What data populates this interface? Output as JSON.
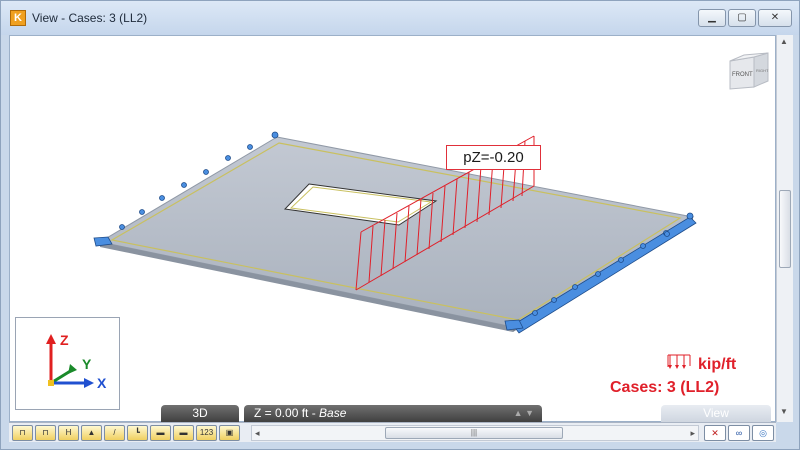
{
  "window": {
    "app_icon": "K",
    "title": "View - Cases: 3 (LL2)",
    "min_icon": "minimize-icon",
    "max_icon": "maximize-icon",
    "close_icon": "close-icon"
  },
  "viewport": {
    "load_label": "pZ=-0.20",
    "nav_cube": {
      "front": "FRONT",
      "right": "RIGHT"
    },
    "axes": {
      "z": "Z",
      "y": "Y",
      "x": "X"
    },
    "legend": {
      "unit": "kip/ft",
      "case": "Cases: 3 (LL2)"
    }
  },
  "bottom_bar": {
    "mode": "3D",
    "elevation": "Z = 0.00 ft - ",
    "elevation_base": "Base",
    "view": "View"
  },
  "toolbar": {
    "buttons": [
      {
        "name": "toolbar-btn-1",
        "glyph": "⊓"
      },
      {
        "name": "toolbar-btn-2",
        "glyph": "⊓"
      },
      {
        "name": "toolbar-btn-3",
        "glyph": "H"
      },
      {
        "name": "toolbar-btn-4",
        "glyph": "▲"
      },
      {
        "name": "toolbar-btn-5",
        "glyph": "/"
      },
      {
        "name": "toolbar-btn-6",
        "glyph": "┗"
      },
      {
        "name": "toolbar-btn-7",
        "glyph": "▬"
      },
      {
        "name": "toolbar-btn-8",
        "glyph": "▬"
      },
      {
        "name": "toolbar-btn-9",
        "glyph": "123"
      },
      {
        "name": "toolbar-btn-10",
        "glyph": "▣"
      }
    ],
    "scroll_left": "◂",
    "scroll_right": "▸",
    "scroll_grip": "|||",
    "right_buttons": [
      {
        "name": "filter-off-icon",
        "glyph": "✕"
      },
      {
        "name": "link-icon",
        "glyph": "∞"
      },
      {
        "name": "view-options-icon",
        "glyph": "◎"
      }
    ]
  },
  "colors": {
    "load": "#e0202a",
    "slab": "#b8c0cc",
    "support": "#4a8ee0",
    "slab_edge": "#c9c060"
  }
}
